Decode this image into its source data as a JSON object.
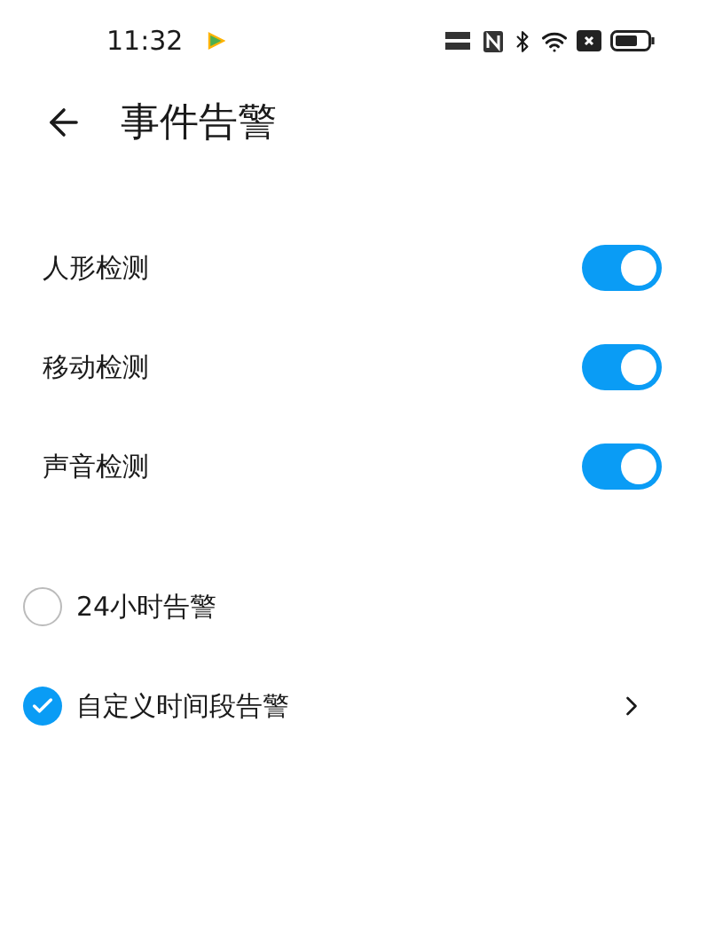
{
  "status_bar": {
    "time": "11:32"
  },
  "header": {
    "title": "事件告警"
  },
  "switches": [
    {
      "label": "人形检测",
      "on": true
    },
    {
      "label": "移动检测",
      "on": true
    },
    {
      "label": "声音检测",
      "on": true
    }
  ],
  "alert_modes": [
    {
      "label": "24小时告警",
      "selected": false,
      "has_chevron": false
    },
    {
      "label": "自定义时间段告警",
      "selected": true,
      "has_chevron": true
    }
  ]
}
